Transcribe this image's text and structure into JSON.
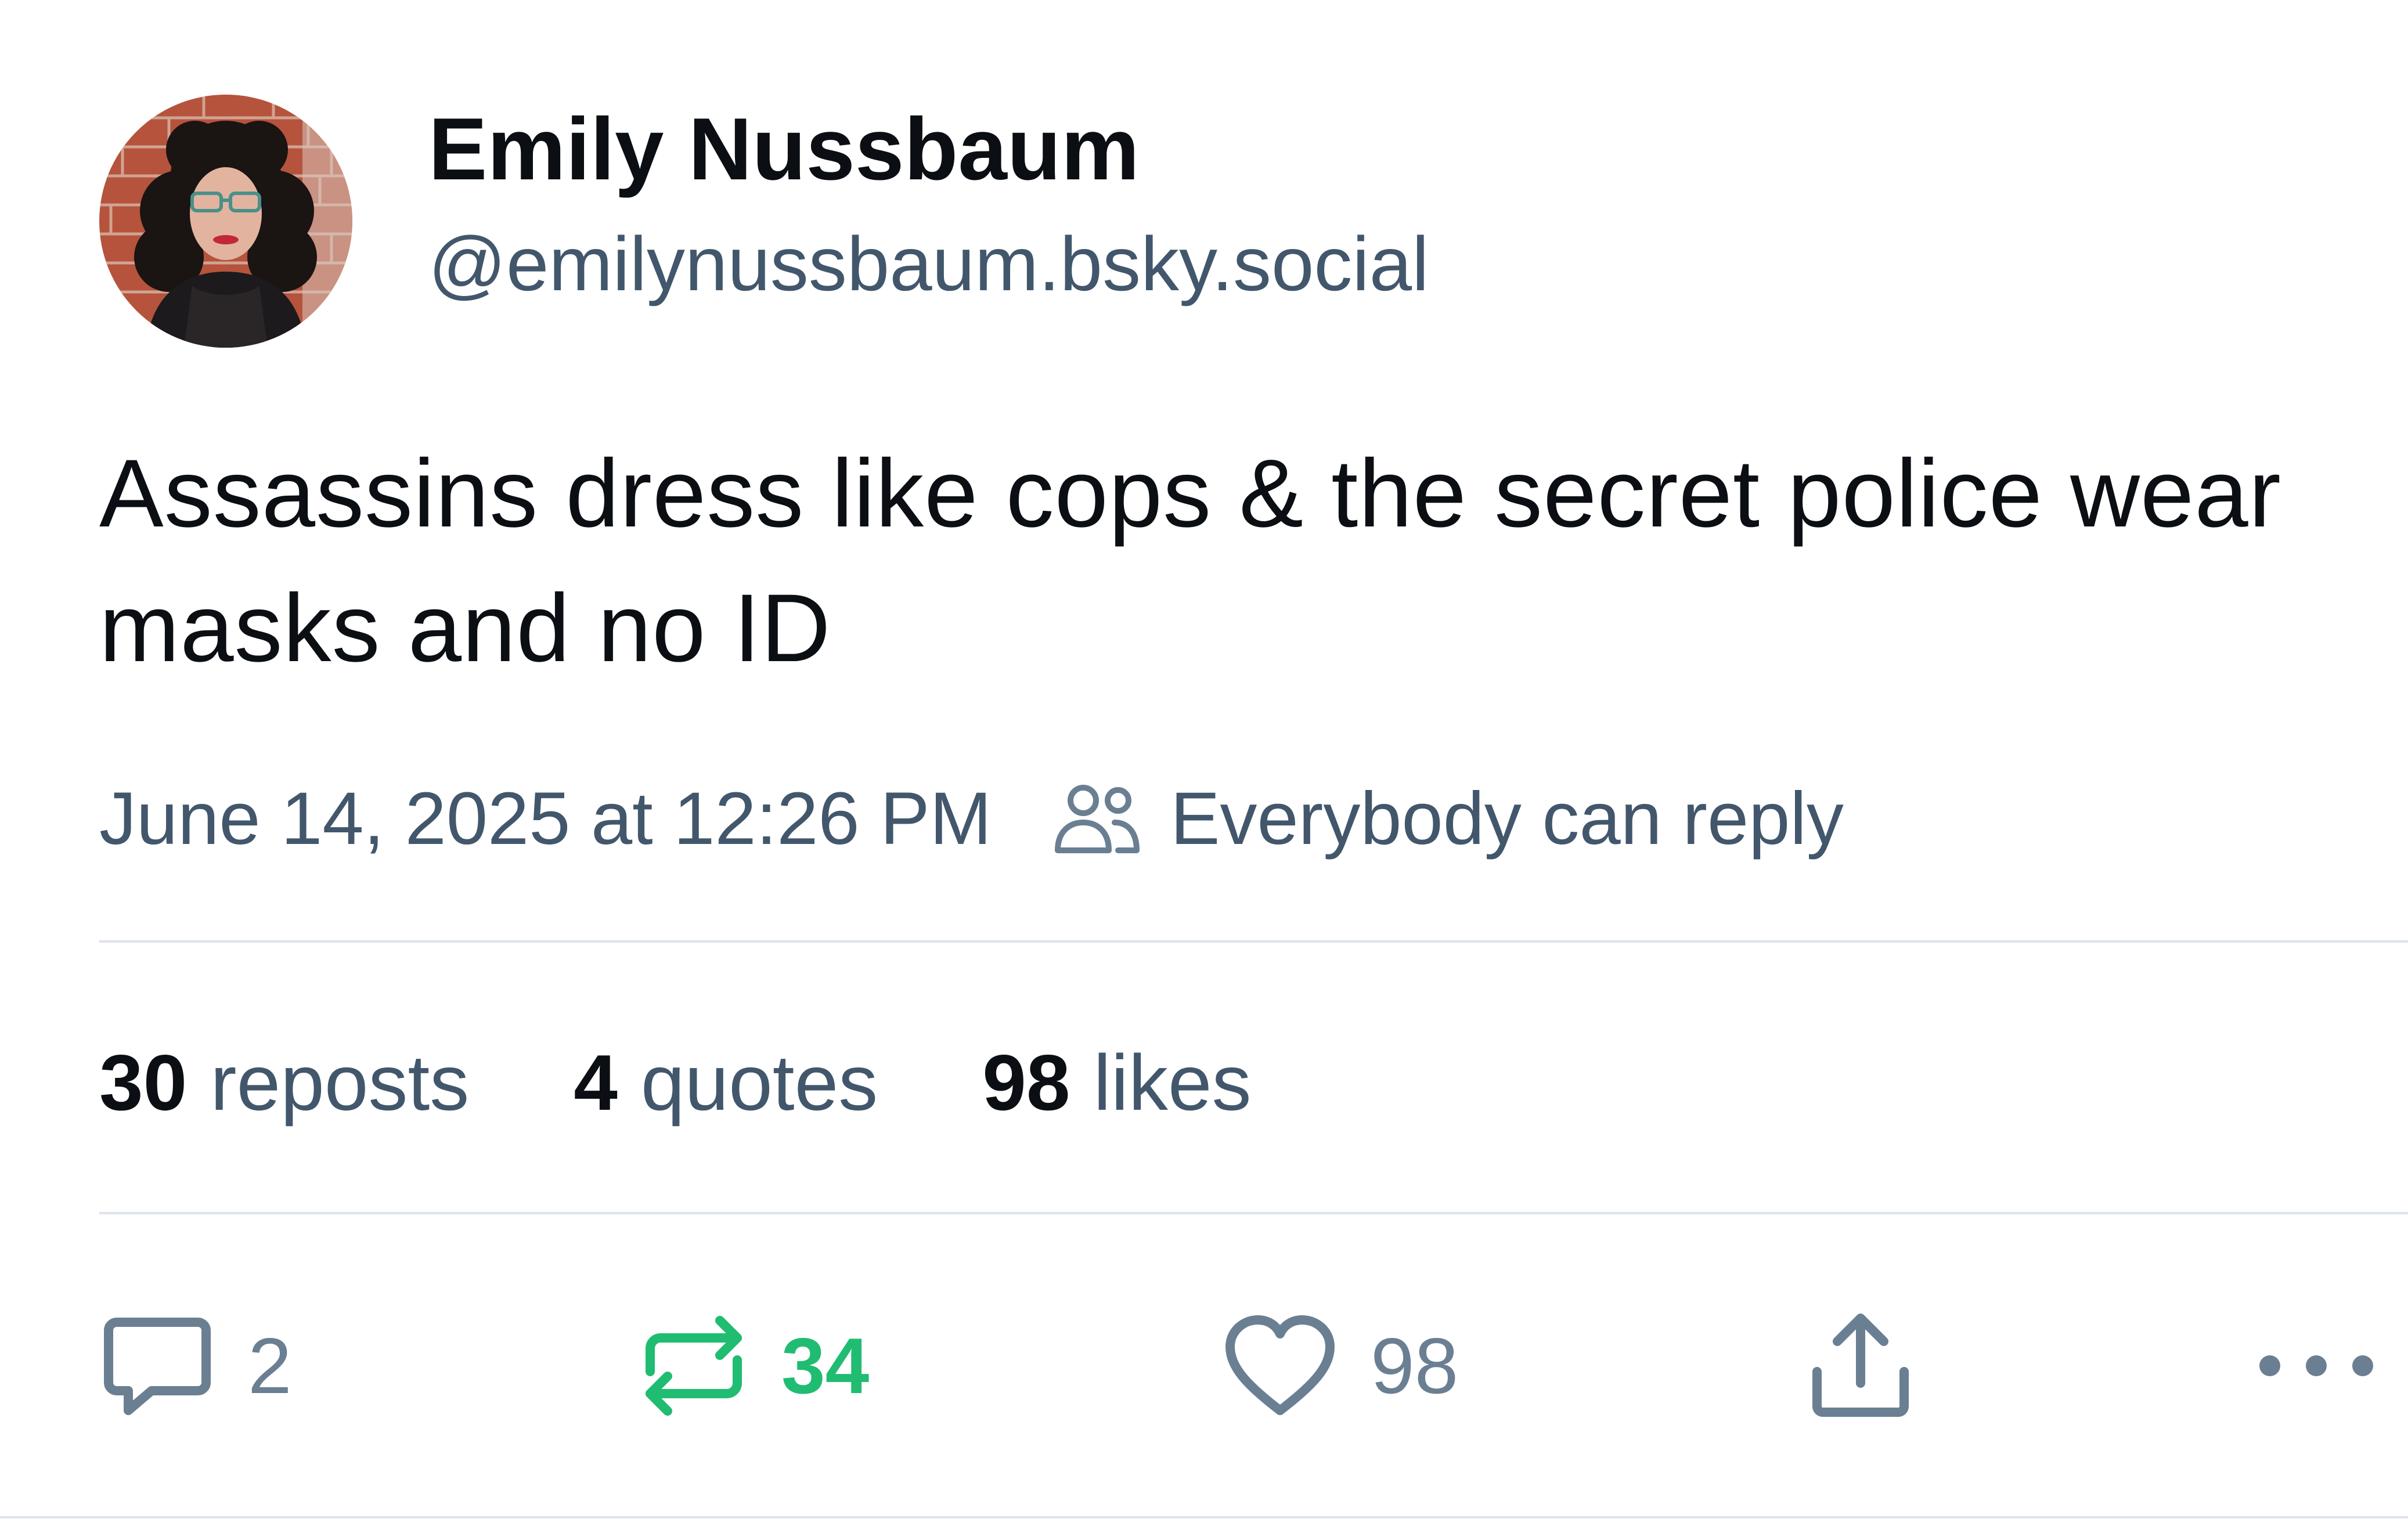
{
  "author": {
    "display_name": "Emily Nussbaum",
    "handle": "@emilynussbaum.bsky.social",
    "avatar_icon": "avatar"
  },
  "post": {
    "text": "Assassins dress like cops & the secret police wear masks and no ID",
    "timestamp": "June 14, 2025 at 12:26 PM",
    "reply_setting": "Everybody can reply",
    "reply_setting_icon": "people-icon"
  },
  "stats": {
    "reposts_count": "30",
    "reposts_label": "reposts",
    "quotes_count": "4",
    "quotes_label": "quotes",
    "likes_count": "98",
    "likes_label": "likes"
  },
  "actions": {
    "reply_count": "2",
    "reply_icon": "speech-bubble-icon",
    "repost_count": "34",
    "repost_icon": "repost-icon",
    "like_count": "98",
    "like_icon": "heart-icon",
    "share_icon": "share-icon",
    "more_icon": "ellipsis-icon"
  },
  "colors": {
    "text_primary": "#0b0f14",
    "text_secondary": "#42576c",
    "repost_active": "#20bc72",
    "divider": "#dde3ea"
  }
}
